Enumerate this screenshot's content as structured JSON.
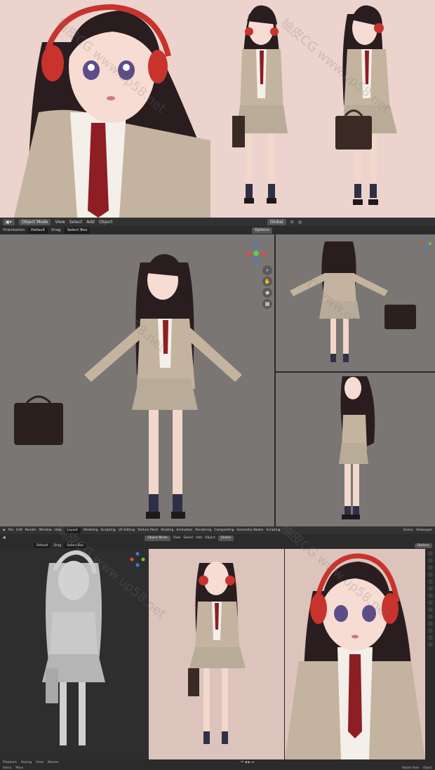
{
  "header": {
    "mode": "Object Mode",
    "menus": [
      "View",
      "Select",
      "Add",
      "Object"
    ],
    "transform": "Global",
    "orientation_label": "Orientation",
    "orientation_value": "Default",
    "drag_label": "Drag",
    "select_box": "Select Box",
    "options": "Options"
  },
  "workspace": {
    "menus": [
      "File",
      "Edit",
      "Render",
      "Window",
      "Help"
    ],
    "tabs": [
      "Layout",
      "Modeling",
      "Sculpting",
      "UV Editing",
      "Texture Paint",
      "Shading",
      "Animation",
      "Rendering",
      "Compositing",
      "Geometry Nodes",
      "Scripting"
    ],
    "scene": "Scene",
    "view_layer": "ViewLayer"
  },
  "sub_header": {
    "mode": "Object Mode",
    "menus": [
      "View",
      "Select",
      "Add",
      "Object"
    ],
    "transform": "Global",
    "orientation_value": "Default",
    "drag_label": "Drag",
    "select_box": "Select Box",
    "options": "Options"
  },
  "timeline": {
    "menus": [
      "Playback",
      "Keying",
      "View",
      "Marker"
    ]
  },
  "status_bar": {
    "items": [
      "Select",
      "Move",
      "Rotate View",
      "Object"
    ]
  },
  "watermark": "柚皮CG www.up58.net",
  "colors": {
    "headphones": "#c8332d",
    "tie": "#8e1d24",
    "blazer": "#c4b39e",
    "skirt": "#b8ab98",
    "hair": "#2a1d20",
    "viewport_bg": "#7b7775",
    "render_bg": "#ecd3cd"
  }
}
